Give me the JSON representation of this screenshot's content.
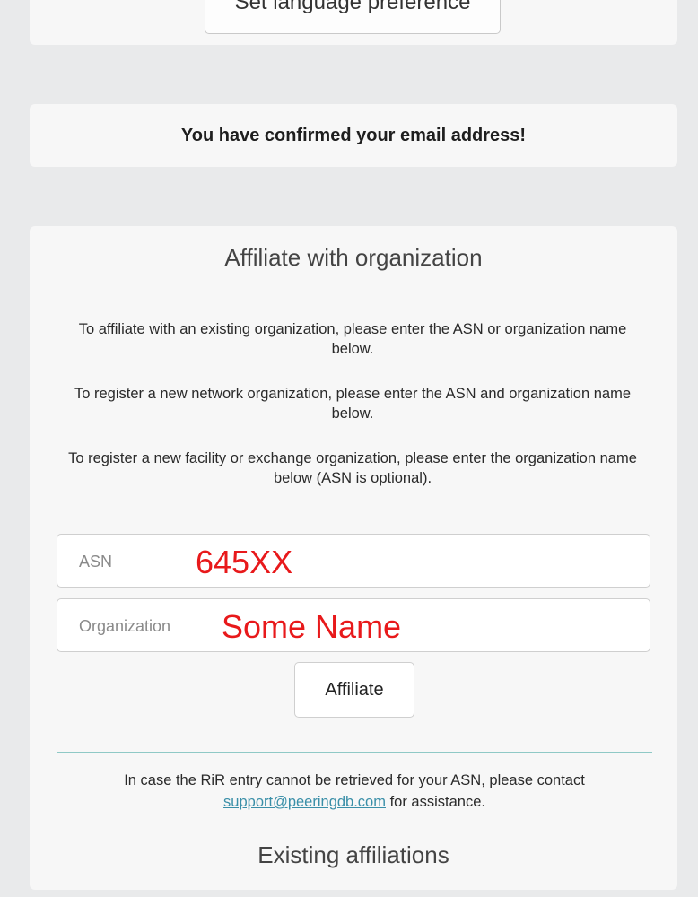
{
  "language": {
    "button_label": "Set language preference"
  },
  "confirm": {
    "message": "You have confirmed your email address!"
  },
  "affiliate": {
    "title": "Affiliate with organization",
    "paragraphs": [
      "To affiliate with an existing organization, please enter the ASN or organization name below.",
      "To register a new network organization, please enter the ASN and organization name below.",
      "To register a new facility or exchange organization, please enter the organization name below (ASN is optional)."
    ],
    "asn_placeholder": "ASN",
    "asn_value": "645XX",
    "org_placeholder": "Organization",
    "org_value": "Some Name",
    "button_label": "Affiliate",
    "support_before": "In case the RiR entry cannot be retrieved for your ASN, please contact ",
    "support_link": "support@peeringdb.com",
    "support_after": " for assistance.",
    "existing_title": "Existing affiliations"
  },
  "colors": {
    "background": "#e9eaeb",
    "card": "#f7f7f7",
    "divider": "#8fc9c6",
    "link": "#3a8fa8",
    "annotation": "#e8191b"
  }
}
